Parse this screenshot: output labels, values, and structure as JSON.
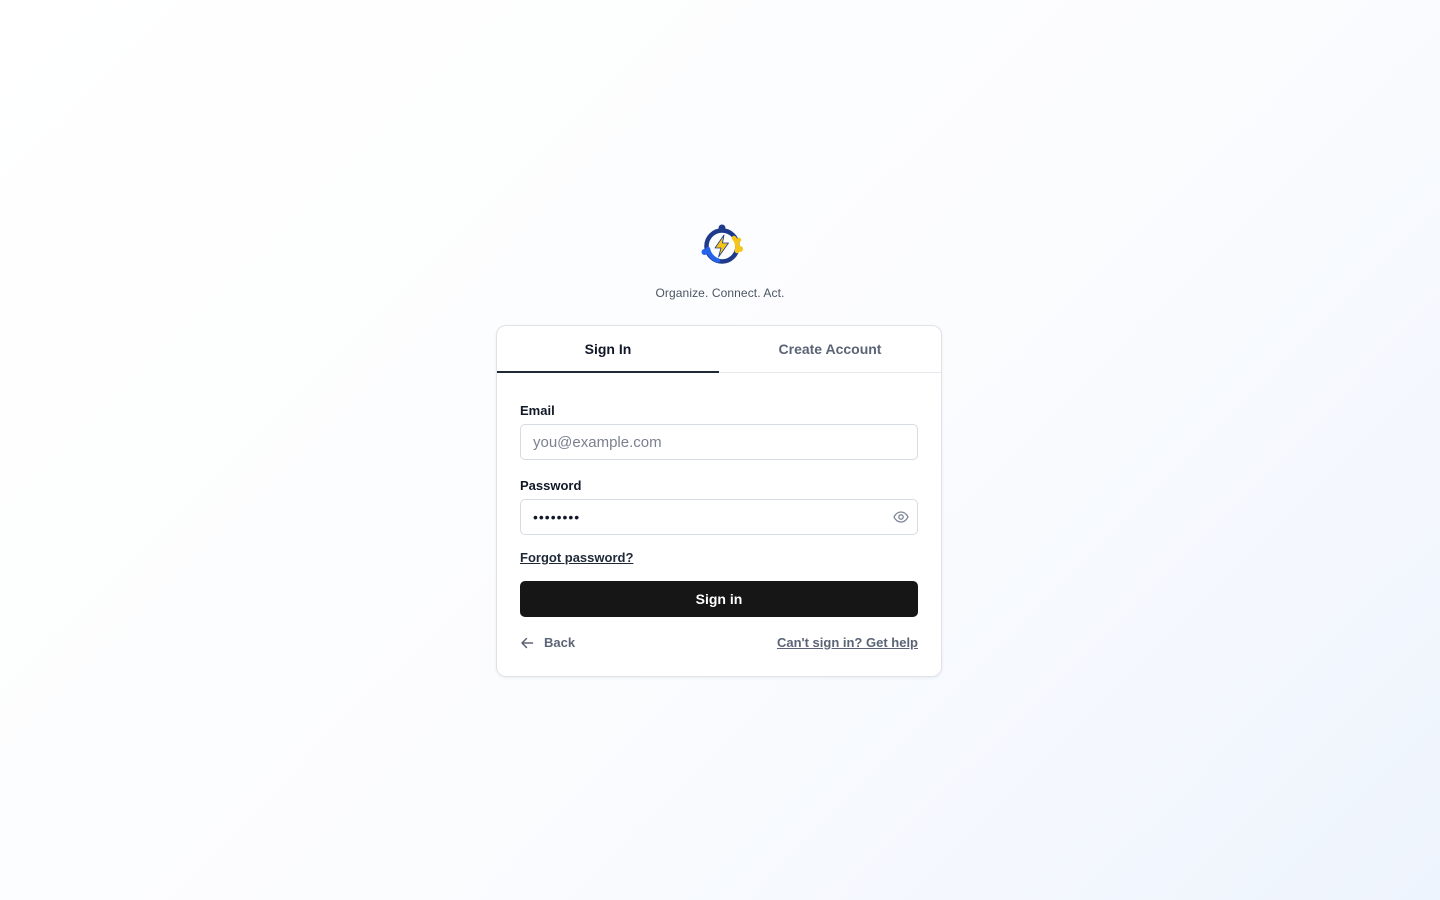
{
  "brand": {
    "logo_icon": "people-lightning-logo-icon",
    "tagline": "Organize. Connect. Act.",
    "colors": {
      "navy": "#1e3a8a",
      "blue": "#2563eb",
      "yellow": "#f5c518"
    }
  },
  "tabs": [
    {
      "label": "Sign In",
      "active": true
    },
    {
      "label": "Create Account",
      "active": false
    }
  ],
  "form": {
    "email": {
      "label": "Email",
      "placeholder": "you@example.com",
      "value": ""
    },
    "password": {
      "label": "Password",
      "value": "password",
      "toggle_icon": "eye-icon"
    },
    "forgot_label": "Forgot password?",
    "submit_label": "Sign in",
    "back_label": "Back",
    "back_icon": "arrow-left-icon",
    "help_label": "Can't sign in? Get help"
  },
  "colors": {
    "button_bg": "#161616",
    "muted_text": "#5b6476",
    "border": "#dfe3e8"
  }
}
